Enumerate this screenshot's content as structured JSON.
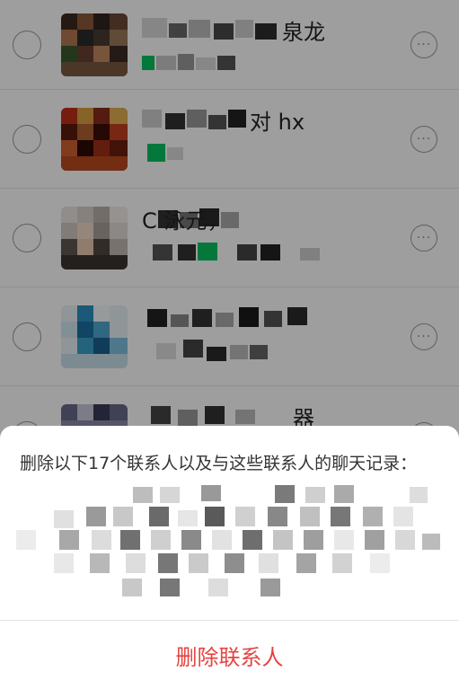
{
  "contacts": [
    {
      "name_visible": "泉龙",
      "sub_visible": "1 ··· 陈"
    },
    {
      "name_visible": "对 hx",
      "sub_visible": ""
    },
    {
      "name_visible": "C 泳元，",
      "sub_visible": ""
    },
    {
      "name_visible": "",
      "sub_visible": ""
    },
    {
      "name_visible": "器",
      "sub_visible": ""
    }
  ],
  "sheet": {
    "message": "删除以下17个联系人以及与这些联系人的聊天记录：",
    "delete_button": "删除联系人"
  },
  "colors": {
    "danger": "#e64340",
    "wechat_green": "#07c160"
  },
  "icons": {
    "radio": "radio-unchecked-icon",
    "more": "more-ellipsis-icon"
  }
}
